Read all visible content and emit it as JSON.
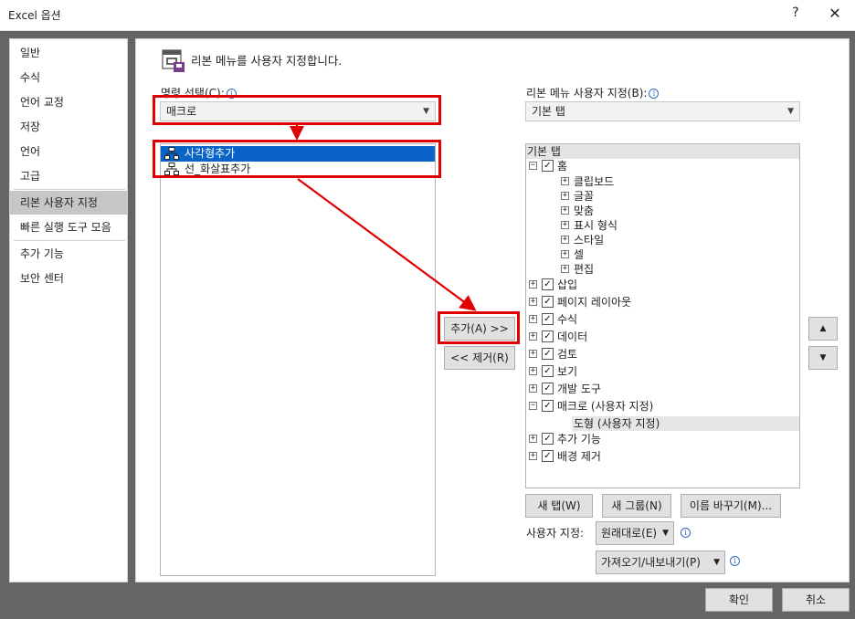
{
  "window": {
    "title": "Excel 옵션",
    "help_glyph": "?",
    "close_glyph": "✕"
  },
  "nav": {
    "items": [
      {
        "label": "일반",
        "selected": false
      },
      {
        "label": "수식",
        "selected": false
      },
      {
        "label": "언어 교정",
        "selected": false
      },
      {
        "label": "저장",
        "selected": false
      },
      {
        "label": "언어",
        "selected": false
      },
      {
        "label": "고급",
        "selected": false
      },
      {
        "label": "리본 사용자 지정",
        "selected": true
      },
      {
        "label": "빠른 실행 도구 모음",
        "selected": false
      },
      {
        "label": "추가 기능",
        "selected": false
      },
      {
        "label": "보안 센터",
        "selected": false
      }
    ]
  },
  "header": {
    "title": "리본 메뉴를 사용자 지정합니다."
  },
  "left": {
    "label": "명령 선택(C):",
    "info_glyph": "i",
    "combo_value": "매크로",
    "commands": [
      {
        "label": "사각형추가",
        "selected": true
      },
      {
        "label": "선_화살표추가",
        "selected": false
      }
    ]
  },
  "middle": {
    "add_label": "추가(A) >>",
    "remove_label": "<< 제거(R)"
  },
  "right": {
    "label": "리본 메뉴 사용자 지정(B):",
    "combo_value": "기본 탭",
    "tree": [
      {
        "label": "기본 탭",
        "level": 0,
        "expander": "",
        "checked": null,
        "header": true
      },
      {
        "label": "홈",
        "level": 0,
        "expander": "minus",
        "checked": true
      },
      {
        "label": "클립보드",
        "level": 1,
        "expander": "plus",
        "checked": null
      },
      {
        "label": "글꼴",
        "level": 1,
        "expander": "plus",
        "checked": null
      },
      {
        "label": "맞춤",
        "level": 1,
        "expander": "plus",
        "checked": null
      },
      {
        "label": "표시 형식",
        "level": 1,
        "expander": "plus",
        "checked": null
      },
      {
        "label": "스타일",
        "level": 1,
        "expander": "plus",
        "checked": null
      },
      {
        "label": "셀",
        "level": 1,
        "expander": "plus",
        "checked": null
      },
      {
        "label": "편집",
        "level": 1,
        "expander": "plus",
        "checked": null
      },
      {
        "label": "삽입",
        "level": 0,
        "expander": "plus",
        "checked": true
      },
      {
        "label": "페이지 레이아웃",
        "level": 0,
        "expander": "plus",
        "checked": true
      },
      {
        "label": "수식",
        "level": 0,
        "expander": "plus",
        "checked": true
      },
      {
        "label": "데이터",
        "level": 0,
        "expander": "plus",
        "checked": true
      },
      {
        "label": "검토",
        "level": 0,
        "expander": "plus",
        "checked": true
      },
      {
        "label": "보기",
        "level": 0,
        "expander": "plus",
        "checked": true
      },
      {
        "label": "개발 도구",
        "level": 0,
        "expander": "plus",
        "checked": true
      },
      {
        "label": "매크로 (사용자 지정)",
        "level": 0,
        "expander": "minus",
        "checked": true
      },
      {
        "label": "도형 (사용자 지정)",
        "level": 2,
        "expander": "",
        "checked": null,
        "highlight": true
      },
      {
        "label": "추가 기능",
        "level": 0,
        "expander": "plus",
        "checked": true
      },
      {
        "label": "배경 제거",
        "level": 0,
        "expander": "plus",
        "checked": true
      }
    ],
    "new_tab_label": "새 탭(W)",
    "new_group_label": "새 그룹(N)",
    "rename_label": "이름 바꾸기(M)...",
    "customize_label": "사용자 지정:",
    "reset_label": "원래대로(E)",
    "import_export_label": "가져오기/내보내기(P)",
    "up_glyph": "▲",
    "down_glyph": "▼"
  },
  "footer": {
    "ok_label": "확인",
    "cancel_label": "취소"
  },
  "colors": {
    "annotation_red": "#e00000",
    "selection_blue": "#0a64c8"
  }
}
